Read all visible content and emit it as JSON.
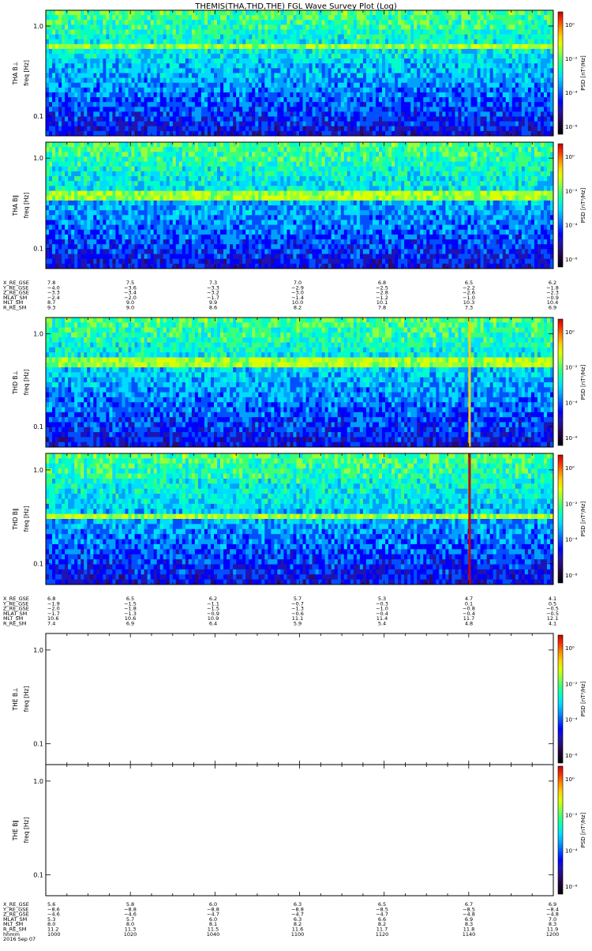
{
  "title": "THEMIS(THA,THD,THE) FGL Wave Survey Plot (Log)",
  "colors": {
    "colormap": [
      "#000000",
      "#1a0033",
      "#2b0a6b",
      "#1e14b4",
      "#0000ff",
      "#0050ff",
      "#00a0ff",
      "#00dcff",
      "#00ffc8",
      "#3cff78",
      "#96ff3c",
      "#dcff00",
      "#ffd200",
      "#ff8c00",
      "#ff3200",
      "#c80000"
    ]
  },
  "chart_data": [
    {
      "type": "heatmap",
      "probe": "THA",
      "panels": [
        {
          "ylabel": "THA B⊥",
          "units": "freq [Hz]",
          "yticks": [
            "1.0",
            "0.1"
          ],
          "ylim_hz": [
            0.06,
            1.5
          ],
          "colorbar_label": "PSD [nT²/Hz]",
          "colorbar_ticks": [
            "10⁰",
            "10⁻²",
            "10⁻⁴",
            "10⁻⁶"
          ],
          "empty": false,
          "bright_band_hz": 0.6
        },
        {
          "ylabel": "THA B∥",
          "units": "freq [Hz]",
          "yticks": [
            "1.0",
            "0.1"
          ],
          "ylim_hz": [
            0.06,
            1.5
          ],
          "colorbar_label": "PSD [nT²/Hz]",
          "colorbar_ticks": [
            "10⁰",
            "10⁻²",
            "10⁻⁴",
            "10⁻⁶"
          ],
          "empty": false,
          "bright_band_hz": 0.38
        }
      ],
      "ephemeris": {
        "labels": [
          "X_RE_GSE",
          "Y_RE_GSE",
          "Z_RE_GSE",
          "MLAT_SM",
          "MLT_SM",
          "R_RE_SM"
        ],
        "values": [
          [
            "7.8",
            "7.5",
            "7.3",
            "7.0",
            "6.8",
            "6.5",
            "6.2"
          ],
          [
            "−4.0",
            "−3.6",
            "−3.3",
            "−2.9",
            "−2.5",
            "−2.2",
            "−1.8"
          ],
          [
            "−3.3",
            "−3.4",
            "−3.2",
            "−3.0",
            "−2.8",
            "−2.6",
            "−2.3"
          ],
          [
            "−2.4",
            "−2.0",
            "−1.7",
            "−1.4",
            "−1.2",
            "−1.0",
            "−0.9"
          ],
          [
            "8.7",
            "9.0",
            "9.9",
            "10.0",
            "10.1",
            "10.3",
            "10.4"
          ],
          [
            "9.3",
            "9.0",
            "8.6",
            "8.2",
            "7.8",
            "7.3",
            "6.9"
          ]
        ]
      }
    },
    {
      "type": "heatmap",
      "probe": "THD",
      "panels": [
        {
          "ylabel": "THD B⊥",
          "units": "freq [Hz]",
          "yticks": [
            "1.0",
            "0.1"
          ],
          "ylim_hz": [
            0.06,
            1.5
          ],
          "colorbar_label": "PSD [nT²/Hz]",
          "colorbar_ticks": [
            "10⁰",
            "10⁻²",
            "10⁻⁴",
            "10⁻⁶"
          ],
          "empty": false,
          "bright_band_hz": 0.5,
          "spike_fraction": 0.835
        },
        {
          "ylabel": "THD B∥",
          "units": "freq [Hz]",
          "yticks": [
            "1.0",
            "0.1"
          ],
          "ylim_hz": [
            0.06,
            1.5
          ],
          "colorbar_label": "PSD [nT²/Hz]",
          "colorbar_ticks": [
            "10⁰",
            "10⁻²",
            "10⁻⁴",
            "10⁻⁶"
          ],
          "empty": false,
          "bright_band_hz": 0.32,
          "spike_fraction": 0.835
        }
      ],
      "ephemeris": {
        "labels": [
          "X_RE_GSE",
          "Y_RE_GSE",
          "Z_RE_GSE",
          "MLAT_SM",
          "MLT_SM",
          "R_RE_SM"
        ],
        "values": [
          [
            "6.8",
            "6.5",
            "6.2",
            "5.7",
            "5.3",
            "4.7",
            "4.1"
          ],
          [
            "−1.9",
            "−1.5",
            "−1.1",
            "−0.7",
            "−0.3",
            "0.1",
            "0.5"
          ],
          [
            "−2.0",
            "−1.8",
            "−1.5",
            "−1.3",
            "−1.0",
            "−0.8",
            "−0.5"
          ],
          [
            "−1.7",
            "−1.3",
            "−0.9",
            "−0.6",
            "−0.4",
            "−0.4",
            "−0.5"
          ],
          [
            "10.6",
            "10.6",
            "10.9",
            "11.1",
            "11.4",
            "11.7",
            "12.1"
          ],
          [
            "7.4",
            "6.9",
            "6.4",
            "5.9",
            "5.4",
            "4.8",
            "4.1"
          ]
        ]
      }
    },
    {
      "type": "heatmap",
      "probe": "THE",
      "panels": [
        {
          "ylabel": "THE B⊥",
          "units": "freq [Hz]",
          "yticks": [
            "1.0",
            "0.1"
          ],
          "ylim_hz": [
            0.06,
            1.5
          ],
          "colorbar_label": "PSD [nT²/Hz]",
          "colorbar_ticks": [
            "10⁰",
            "10⁻²",
            "10⁻⁴",
            "10⁻⁶"
          ],
          "empty": true
        },
        {
          "ylabel": "THE B∥",
          "units": "freq [Hz]",
          "yticks": [
            "1.0",
            "0.1"
          ],
          "ylim_hz": [
            0.06,
            1.5
          ],
          "colorbar_label": "PSD [nT²/Hz]",
          "colorbar_ticks": [
            "10⁰",
            "10⁻²",
            "10⁻⁴",
            "10⁻⁶"
          ],
          "empty": true
        }
      ],
      "ephemeris": {
        "labels": [
          "X_RE_GSE",
          "Y_RE_GSE",
          "Z_RE_GSE",
          "MLAT_SM",
          "MLT_SM",
          "R_RE_SM",
          "hhmm",
          "2016 Sep 07"
        ],
        "values": [
          [
            "5.6",
            "5.8",
            "6.0",
            "6.3",
            "6.5",
            "6.7",
            "6.9"
          ],
          [
            "−8.6",
            "−8.8",
            "−8.8",
            "−8.8",
            "−8.5",
            "−8.5",
            "−8.4"
          ],
          [
            "−4.6",
            "−4.6",
            "−4.7",
            "−4.7",
            "−4.7",
            "−4.8",
            "−4.8"
          ],
          [
            "5.3",
            "5.7",
            "6.0",
            "6.3",
            "6.6",
            "6.9",
            "7.0"
          ],
          [
            "8.0",
            "8.0",
            "8.1",
            "8.2",
            "8.2",
            "8.3",
            "8.3"
          ],
          [
            "11.2",
            "11.3",
            "11.5",
            "11.6",
            "11.7",
            "11.8",
            "11.9"
          ],
          [
            "1000",
            "1020",
            "1040",
            "1100",
            "1120",
            "1140",
            "1200"
          ]
        ]
      }
    }
  ]
}
